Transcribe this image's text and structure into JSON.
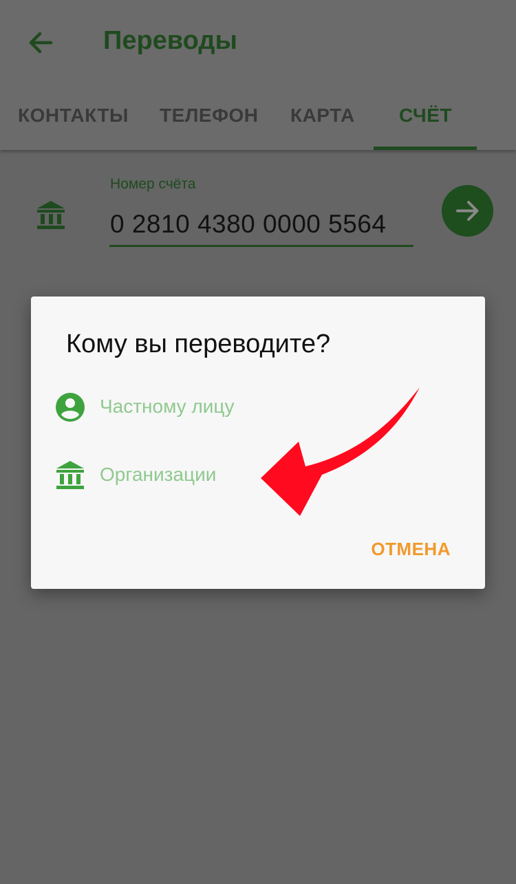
{
  "header": {
    "title": "Переводы",
    "back_icon": "arrow-left-icon"
  },
  "tabs": [
    {
      "label": "КОНТАКТЫ",
      "active": false
    },
    {
      "label": "ТЕЛЕФОН",
      "active": false
    },
    {
      "label": "КАРТА",
      "active": false
    },
    {
      "label": "СЧЁТ",
      "active": true
    }
  ],
  "account_field": {
    "label": "Номер счёта",
    "value": "0 2810 4380 0000 5564",
    "icon": "bank-icon",
    "next_icon": "arrow-right-icon"
  },
  "dialog": {
    "title": "Кому вы переводите?",
    "options": [
      {
        "label": "Частному лицу",
        "icon": "person-icon"
      },
      {
        "label": "Организации",
        "icon": "bank-icon"
      }
    ],
    "cancel_label": "ОТМЕНА"
  },
  "colors": {
    "primary": "#1f4a1f",
    "option_text": "#8fc98f",
    "icon_green": "#3ea33e",
    "accent_orange": "#f19a2c",
    "annotation_arrow": "#ff0a1e"
  }
}
